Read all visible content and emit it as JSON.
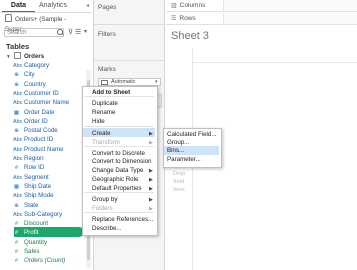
{
  "tabs": {
    "data": "Data",
    "analytics": "Analytics"
  },
  "datasource": "Orders+ (Sample - Super...",
  "search": {
    "placeholder": "Search"
  },
  "tables_title": "Tables",
  "table_name": "Orders",
  "fields": [
    {
      "label": "Category",
      "kind": "dim",
      "icon": "Abc"
    },
    {
      "label": "City",
      "kind": "dim",
      "icon": "globe"
    },
    {
      "label": "Country",
      "kind": "dim",
      "icon": "globe"
    },
    {
      "label": "Customer ID",
      "kind": "dim",
      "icon": "Abc"
    },
    {
      "label": "Customer Name",
      "kind": "dim",
      "icon": "Abc"
    },
    {
      "label": "Order Date",
      "kind": "dim",
      "icon": "date"
    },
    {
      "label": "Order ID",
      "kind": "dim",
      "icon": "Abc"
    },
    {
      "label": "Postal Code",
      "kind": "dim",
      "icon": "globe"
    },
    {
      "label": "Product ID",
      "kind": "dim",
      "icon": "Abc"
    },
    {
      "label": "Product Name",
      "kind": "dim",
      "icon": "Abc"
    },
    {
      "label": "Region",
      "kind": "dim",
      "icon": "Abc"
    },
    {
      "label": "Row ID",
      "kind": "dim",
      "icon": "#"
    },
    {
      "label": "Segment",
      "kind": "dim",
      "icon": "Abc"
    },
    {
      "label": "Ship Date",
      "kind": "dim",
      "icon": "date"
    },
    {
      "label": "Ship Mode",
      "kind": "dim",
      "icon": "Abc"
    },
    {
      "label": "State",
      "kind": "dim",
      "icon": "globe"
    },
    {
      "label": "Sub-Category",
      "kind": "dim",
      "icon": "Abc"
    },
    {
      "label": "Discount",
      "kind": "mea",
      "icon": "#"
    },
    {
      "label": "Profit",
      "kind": "mea",
      "icon": "#"
    },
    {
      "label": "Quantity",
      "kind": "mea",
      "icon": "#"
    },
    {
      "label": "Sales",
      "kind": "mea",
      "icon": "#"
    },
    {
      "label": "Orders (Count)",
      "kind": "mea",
      "icon": "#"
    }
  ],
  "cards": {
    "pages": "Pages",
    "filters": "Filters",
    "marks": "Marks",
    "marks_type": "Automatic"
  },
  "shelves": {
    "columns": "Columns",
    "rows": "Rows"
  },
  "sheet_title": "Sheet 3",
  "drop_field_here": "Drop field here",
  "context_menu": {
    "items": [
      {
        "label": "Add to Sheet",
        "bold": true
      },
      {
        "label": "Duplicate"
      },
      {
        "label": "Rename"
      },
      {
        "label": "Hide"
      },
      {
        "label": "Create",
        "submenu": true,
        "highlighted": true
      },
      {
        "label": "Transform",
        "submenu": true,
        "disabled": true
      },
      {
        "label": "Convert to Discrete"
      },
      {
        "label": "Convert to Dimension"
      },
      {
        "label": "Change Data Type",
        "submenu": true
      },
      {
        "label": "Geographic Role",
        "submenu": true
      },
      {
        "label": "Default Properties",
        "submenu": true
      },
      {
        "label": "Group by",
        "submenu": true
      },
      {
        "label": "Folders",
        "submenu": true,
        "disabled": true
      },
      {
        "label": "Replace References..."
      },
      {
        "label": "Describe..."
      }
    ]
  },
  "submenu": {
    "items": [
      {
        "label": "Calculated Field..."
      },
      {
        "label": "Group..."
      },
      {
        "label": "Bins...",
        "highlighted": true
      },
      {
        "label": "Parameter..."
      }
    ]
  },
  "colors": {
    "accent": "#1f77b4",
    "measure_selected": "#1aa96b",
    "menu_highlight": "#cfe3f7"
  }
}
